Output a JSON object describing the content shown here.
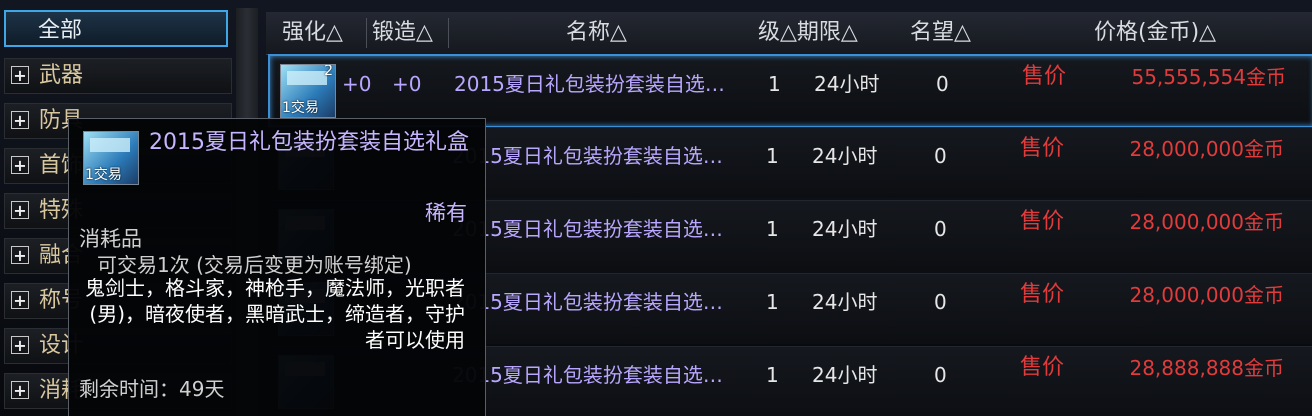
{
  "sidebar": {
    "all_label": "全部",
    "categories": [
      {
        "label": "武器"
      },
      {
        "label": "防具"
      },
      {
        "label": "首饰"
      },
      {
        "label": "特殊"
      },
      {
        "label": "融合"
      },
      {
        "label": "称号"
      },
      {
        "label": "设计"
      },
      {
        "label": "消耗"
      }
    ]
  },
  "table": {
    "headers": {
      "enhance": "强化△",
      "forge": "锻造△",
      "name": "名称△",
      "level_period": "级△期限△",
      "fame": "名望△",
      "price": "价格(金币)△"
    },
    "rows": [
      {
        "qty": "2",
        "trade": "1交易",
        "enhance": "+0",
        "forge": "+0",
        "name": "2015夏日礼包装扮套装自选…",
        "level": "1",
        "period": "24小时",
        "fame": "0",
        "sale": "售价",
        "price": "55,555,554金币"
      },
      {
        "qty": "",
        "trade": "",
        "enhance": "",
        "forge": "",
        "name": "2015夏日礼包装扮套装自选…",
        "level": "1",
        "period": "24小时",
        "fame": "0",
        "sale": "售价",
        "price": "28,000,000金币"
      },
      {
        "qty": "",
        "trade": "",
        "enhance": "",
        "forge": "",
        "name": "2015夏日礼包装扮套装自选…",
        "level": "1",
        "period": "24小时",
        "fame": "0",
        "sale": "售价",
        "price": "28,000,000金币"
      },
      {
        "qty": "",
        "trade": "",
        "enhance": "",
        "forge": "",
        "name": "2015夏日礼包装扮套装自选…",
        "level": "1",
        "period": "24小时",
        "fame": "0",
        "sale": "售价",
        "price": "28,000,000金币"
      },
      {
        "qty": "",
        "trade": "",
        "enhance": "",
        "forge": "",
        "name": "2015夏日礼包装扮套装自选…",
        "level": "1",
        "period": "24小时",
        "fame": "0",
        "sale": "售价",
        "price": "28,888,888金币"
      }
    ]
  },
  "tooltip": {
    "trade": "1交易",
    "title": "2015夏日礼包装扮套装自选礼盒",
    "rarity": "稀有",
    "type": "消耗品",
    "trade_info": "可交易1次 (交易后变更为账号绑定)",
    "jobs": "鬼剑士，格斗家，神枪手，魔法师，光职者(男)，暗夜使者，黑暗武士，缔造者，守护者可以使用",
    "remaining": "剩余时间：49天"
  }
}
